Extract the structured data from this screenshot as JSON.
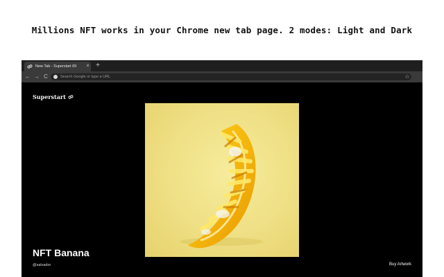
{
  "headline": "Millions NFT works in your Chrome new tab page. 2 modes: Light and Dark",
  "browser": {
    "tab": {
      "title": "New Tab - Superstart 69",
      "close_glyph": "×",
      "favicon": "sixtynine-icon"
    },
    "new_tab_glyph": "+",
    "nav": {
      "back_glyph": "←",
      "forward_glyph": "→",
      "reload_glyph": "C"
    },
    "omnibox": {
      "placeholder": "Search Google or type a URL",
      "icon": "google-icon"
    },
    "star_glyph": "☆"
  },
  "page": {
    "brand": "Superstart",
    "artwork": {
      "title": "NFT Banana",
      "author": "@salvador",
      "subject": "banana-sculpture"
    },
    "buy_label": "Buy Artwork"
  },
  "colors": {
    "browser_bg": "#000000",
    "toolbar": "#3a3a3a",
    "tabstrip": "#1f1f1f",
    "artwork_bg": "#efdf84",
    "banana": "#f2b705"
  }
}
